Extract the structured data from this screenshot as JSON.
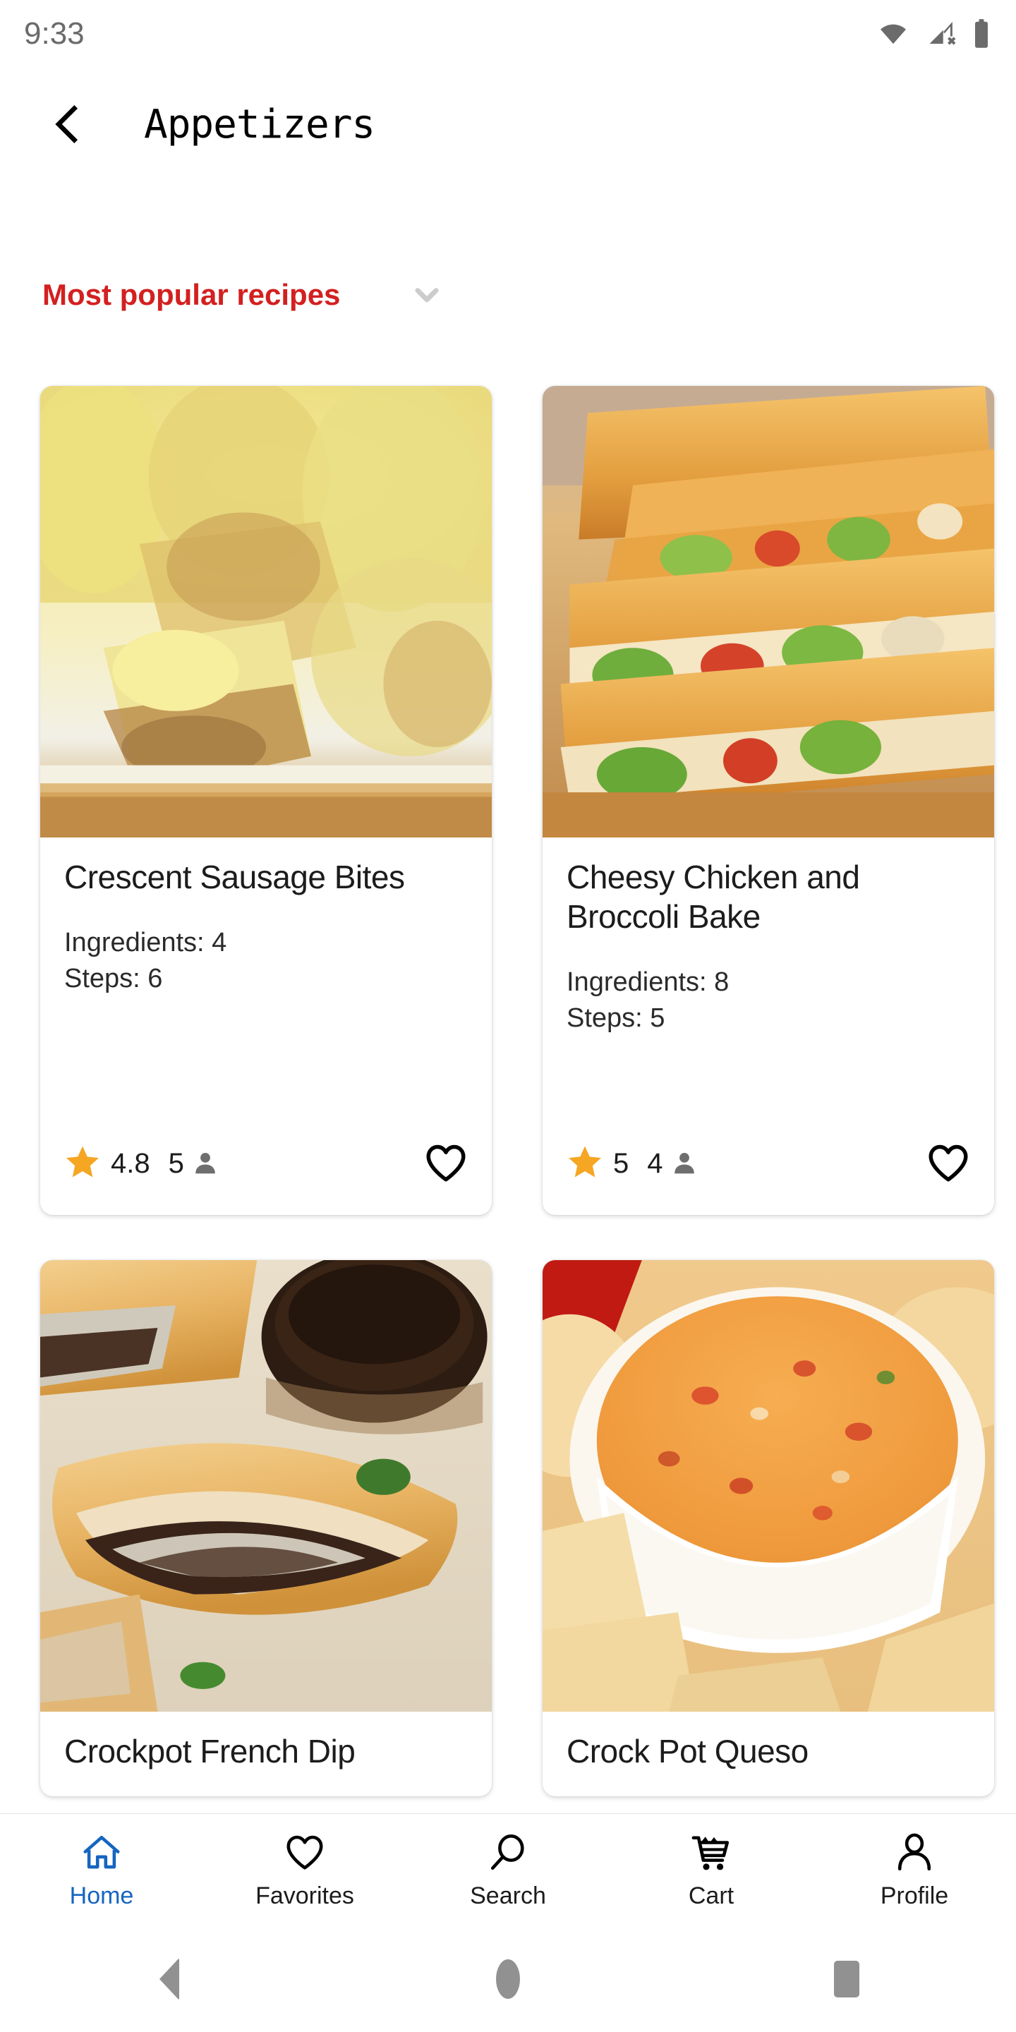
{
  "status_bar": {
    "time": "9:33",
    "icons": [
      "wifi-full-icon",
      "cellular-no-sim-icon",
      "battery-full-icon"
    ]
  },
  "app_bar": {
    "back_icon": "chevron-left-icon",
    "title": "Appetizers"
  },
  "filter": {
    "label": "Most popular recipes",
    "chevron_icon": "chevron-down-icon",
    "chevron_color": "#cccccc",
    "label_color": "#d32020"
  },
  "recipes": [
    {
      "title": "Crescent Sausage Bites",
      "ingredients_label": "Ingredients: 4",
      "steps_label": "Steps: 6",
      "rating": "4.8",
      "rating_count": "5",
      "star_icon": "star-filled-icon",
      "person_icon": "person-icon",
      "favorite_icon": "heart-outline-icon",
      "favorited": false,
      "photo": "crescent-sausage-bites-photo"
    },
    {
      "title": "Cheesy Chicken and Broccoli Bake",
      "ingredients_label": "Ingredients: 8",
      "steps_label": "Steps: 5",
      "rating": "5",
      "rating_count": "4",
      "star_icon": "star-filled-icon",
      "person_icon": "person-icon",
      "favorite_icon": "heart-outline-icon",
      "favorited": false,
      "photo": "cheesy-chicken-broccoli-bake-photo"
    },
    {
      "title": "Crockpot French Dip",
      "photo": "crockpot-french-dip-photo"
    },
    {
      "title": "Crock Pot Queso",
      "photo": "crock-pot-queso-photo"
    }
  ],
  "bottom_nav": {
    "active_color": "#1565c0",
    "items": [
      {
        "label": "Home",
        "icon": "home-icon",
        "active": true
      },
      {
        "label": "Favorites",
        "icon": "heart-outline-icon",
        "active": false
      },
      {
        "label": "Search",
        "icon": "search-icon",
        "active": false
      },
      {
        "label": "Cart",
        "icon": "shopping-cart-icon",
        "active": false
      },
      {
        "label": "Profile",
        "icon": "person-outline-icon",
        "active": false
      }
    ]
  },
  "system_nav": {
    "back": "android-back-button",
    "home": "android-home-button",
    "recents": "android-recents-button"
  },
  "colors": {
    "star": "#f5a623",
    "accent_red": "#d32020",
    "nav_active": "#1565c0",
    "text_primary": "#1c1c1c",
    "person_grey": "#6e6e6e"
  }
}
